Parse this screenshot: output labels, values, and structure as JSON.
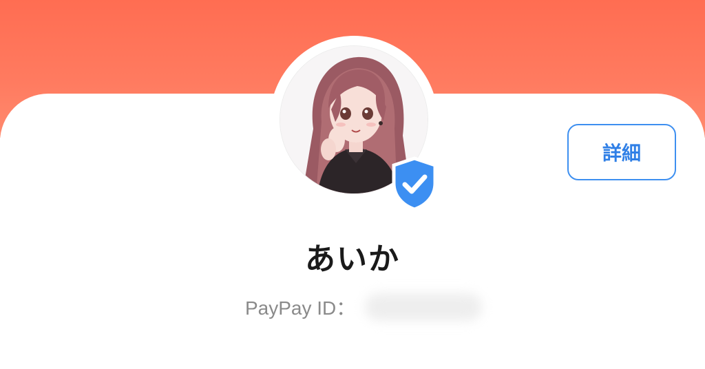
{
  "profile": {
    "name": "あいか",
    "details_button": "詳細",
    "id_label": "PayPay ID：",
    "id_value": "",
    "verified": true
  },
  "icons": {
    "avatar": "anime-girl-avatar",
    "badge": "shield-check-icon"
  },
  "colors": {
    "header_gradient_top": "#ff6d52",
    "header_gradient_bottom": "#ff8a6e",
    "accent_blue": "#3d8ff0",
    "badge_blue": "#3c8ff2",
    "name_text": "#1a1a1a",
    "label_text": "#8a8a8a"
  }
}
